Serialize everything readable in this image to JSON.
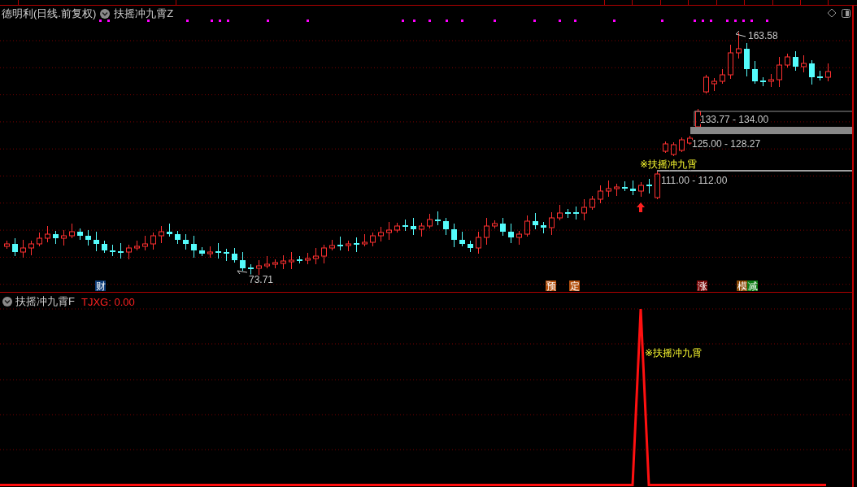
{
  "header": {
    "stock": "德明利(日线.前复权)",
    "indicator": "扶摇冲九霄Z"
  },
  "price_chart": {
    "high_label": "163.58",
    "low_label": "73.71",
    "signal_label": "※扶摇冲九霄",
    "zones": [
      {
        "kind": "box",
        "label": "133.77 - 134.00"
      },
      {
        "kind": "bar",
        "label": "125.00 - 128.27"
      },
      {
        "kind": "line",
        "label": "111.00 - 112.00"
      }
    ],
    "event_badges": [
      {
        "text": "财",
        "color": "#0e3c78"
      },
      {
        "text": "预",
        "color": "#b4500e"
      },
      {
        "text": "定",
        "color": "#b4500e"
      },
      {
        "text": "涨",
        "color": "#7a0a0a"
      },
      {
        "text": "模",
        "color": "#8c4a06"
      },
      {
        "text": "减",
        "color": "#0b7a12"
      }
    ]
  },
  "indicator_panel": {
    "name": "扶摇冲九霄F",
    "reading": "TJXG: 0.00",
    "signal_label": "※扶摇冲九霄"
  }
}
